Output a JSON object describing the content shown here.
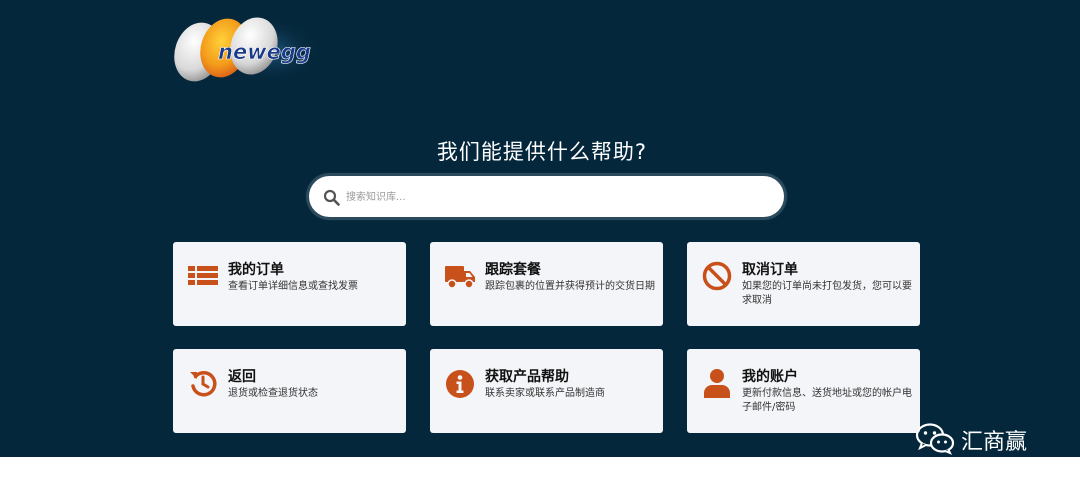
{
  "brand": {
    "logo_text": "newegg"
  },
  "hero": {
    "headline": "我们能提供什么帮助?",
    "search_placeholder": "搜索知识库..."
  },
  "cards": [
    {
      "icon": "list-icon",
      "title": "我的订单",
      "desc": "查看订单详细信息或查找发票"
    },
    {
      "icon": "truck-icon",
      "title": "跟踪套餐",
      "desc": "跟踪包裹的位置并获得预计的交货日期"
    },
    {
      "icon": "cancel-icon",
      "title": "取消订单",
      "desc": "如果您的订单尚未打包发货，您可以要求取消"
    },
    {
      "icon": "return-icon",
      "title": "返回",
      "desc": "退货或检查退货状态"
    },
    {
      "icon": "info-icon",
      "title": "获取产品帮助",
      "desc": "联系卖家或联系产品制造商"
    },
    {
      "icon": "user-icon",
      "title": "我的账户",
      "desc": "更新付款信息、送货地址或您的帐户电子邮件/密码"
    }
  ],
  "watermark": {
    "text": "汇商赢"
  },
  "colors": {
    "background": "#04273b",
    "accent": "#c8501a",
    "card": "#f4f5f8"
  }
}
